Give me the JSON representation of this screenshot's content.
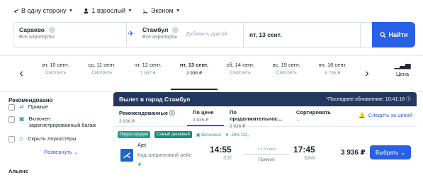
{
  "options": {
    "trip_type": "В одну сторону",
    "passengers": "1 взрослый",
    "cabin": "Эконом"
  },
  "search": {
    "from_city": "Сараево",
    "from_sub": "Все аэропорты",
    "to_city": "Стамбул",
    "to_sub": "Все аэропорты",
    "add_other": "Добавить другой",
    "date": "пт, 13 сент.",
    "find_label": "Найти"
  },
  "date_strip": {
    "days": [
      {
        "date": "вт, 10 сент.",
        "price": "Смотреть"
      },
      {
        "date": "ср, 11 сент.",
        "price": "Смотреть"
      },
      {
        "date": "чт, 12 сент.",
        "price": "7 587 ₽"
      },
      {
        "date": "пт, 13 сент.",
        "price": "3 936 ₽"
      },
      {
        "date": "сб, 14 сент.",
        "price": "Смотреть"
      },
      {
        "date": "вс, 15 сент.",
        "price": "Смотреть"
      },
      {
        "date": "пн, 16 сент.",
        "price": "8 756 ₽"
      }
    ],
    "price_graph_label": "Цена"
  },
  "sidebar": {
    "heading": "Рекомендовано",
    "filters": [
      {
        "label": "Прямые"
      },
      {
        "label": "Включен зарегистрированный багаж"
      },
      {
        "label": "Скрыть лоукостеры"
      }
    ],
    "expand": "Развернуть",
    "aliance": "Альянс"
  },
  "results": {
    "header_title": "Вылет в город Стамбул",
    "updated": "*Последнее обновление: 10:41:18",
    "sorts": [
      {
        "name": "Рекомендованные",
        "value": "3 936 ₽"
      },
      {
        "name": "По цене",
        "value": "3 936 ₽"
      },
      {
        "name": "По продолжительнос...",
        "value": "3 936 ₽"
      },
      {
        "name": "Сортировать",
        "value": ""
      }
    ],
    "follow": "Следить за ценой",
    "badges": {
      "b1": "Лидер продаж",
      "b2": "Самый дешевый",
      "b3": "Включено",
      "b4": "-26% CO₂"
    },
    "flight": {
      "airline": "Ajet",
      "codeshare": "Код-шеринговый рейс",
      "dep_time": "14:55",
      "dep_airport": "SJJ",
      "duration": "1 ч 50 мин",
      "nonstop": "Прямой",
      "arr_time": "17:45",
      "arr_airport": "SAW",
      "price": "3 936 ₽",
      "select_label": "Выбрать"
    }
  },
  "colors": {
    "accent": "#2961e6",
    "header": "#24375f",
    "teal": "#2a9d8f"
  }
}
